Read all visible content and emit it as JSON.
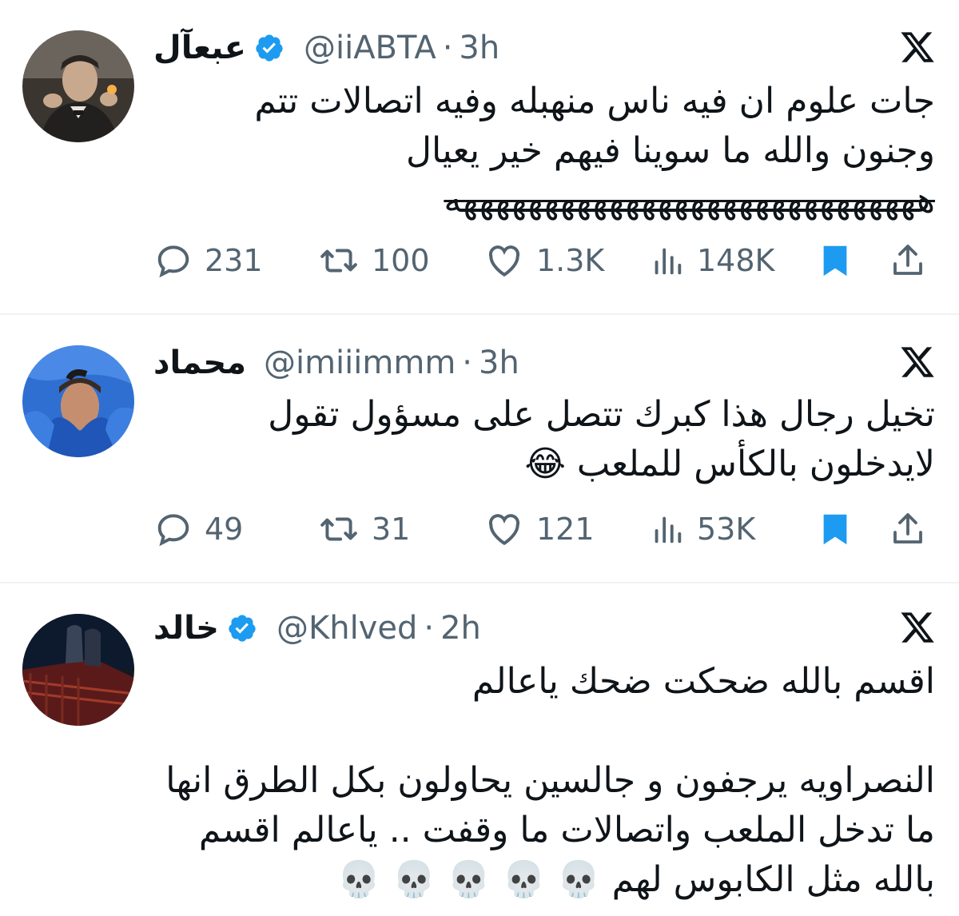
{
  "colors": {
    "accent": "#1d9bf0",
    "secondary_text": "#536471",
    "text": "#0f1419",
    "divider": "#eff3f4"
  },
  "tweets": [
    {
      "name": "عبعآل",
      "verified": true,
      "handle": "@iiABTA",
      "separator": "·",
      "time": "3h",
      "lines": [
        "جات علوم ان فيه ناس منهبله وفيه اتصالات تتم",
        "وجنون والله ما سوينا فيهم خير يعيال",
        "هههههههههههههههههههههههههههههه"
      ],
      "replies": "231",
      "retweets": "100",
      "likes": "1.3K",
      "views": "148K",
      "bookmarked": true,
      "avatar_icon": "profile-photo"
    },
    {
      "name": "محماد",
      "verified": false,
      "handle": "@imiiimmm",
      "separator": "·",
      "time": "3h",
      "lines": [
        "تخيل رجال هذا كبرك تتصل على مسؤول تقول",
        "لايدخلون بالكأس للملعب 😂"
      ],
      "replies": "49",
      "retweets": "31",
      "likes": "121",
      "views": "53K",
      "bookmarked": true,
      "avatar_icon": "profile-photo"
    },
    {
      "name": "خالد",
      "verified": true,
      "handle": "@Khlved",
      "separator": "·",
      "time": "2h",
      "lines": [
        "اقسم بالله ضحكت ضحك ياعالم",
        "",
        "النصراويه يرجفون و جالسين يحاولون بكل الطرق انها",
        "ما تدخل الملعب واتصالات ما وقفت .. ياعالم اقسم",
        "بالله مثل الكابوس لهم 💀 💀 💀 💀 💀"
      ],
      "avatar_icon": "profile-photo"
    }
  ]
}
